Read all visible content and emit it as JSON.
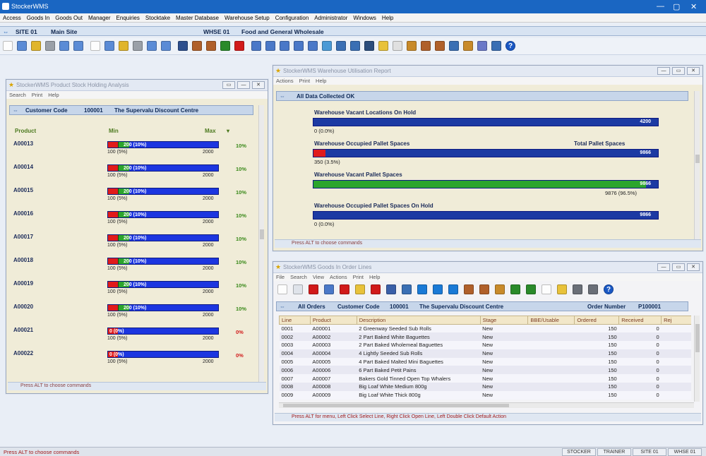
{
  "app": {
    "title": "StockerWMS"
  },
  "menu": [
    "Access",
    "Goods In",
    "Goods Out",
    "Manager",
    "Enquiries",
    "Stocktake",
    "Master Database",
    "Warehouse Setup",
    "Configuration",
    "Administrator",
    "Windows",
    "Help"
  ],
  "site": {
    "code": "SITE 01",
    "name": "Main Site",
    "warehouse": "WHSE 01",
    "warehouse_name": "Food and General Wholesale"
  },
  "stock_window": {
    "title": "StockerWMS Product Stock Holding Analysis",
    "menu": [
      "Search",
      "Print",
      "Help"
    ],
    "header_label": "Customer Code",
    "customer_code": "100001",
    "customer_name": "The Supervalu Discount Centre",
    "col_product": "Product",
    "col_min": "Min",
    "col_max": "Max",
    "status": "Press ALT to choose commands",
    "colors": {
      "bar_blue": "#1c36e0",
      "bar_red": "#e01b1b",
      "bar_green": "#2ca52c",
      "pct_ok": "#3a8a1a",
      "pct_bad": "#d11a1a"
    },
    "rows": [
      {
        "product": "A00013",
        "label": "200 (10%)",
        "level": 0.1,
        "min": "100 (5%)",
        "max": "2000",
        "pct": "10%",
        "ok": true
      },
      {
        "product": "A00014",
        "label": "200 (10%)",
        "level": 0.1,
        "min": "100 (5%)",
        "max": "2000",
        "pct": "10%",
        "ok": true
      },
      {
        "product": "A00015",
        "label": "200 (10%)",
        "level": 0.1,
        "min": "100 (5%)",
        "max": "2000",
        "pct": "10%",
        "ok": true
      },
      {
        "product": "A00016",
        "label": "200 (10%)",
        "level": 0.1,
        "min": "100 (5%)",
        "max": "2000",
        "pct": "10%",
        "ok": true
      },
      {
        "product": "A00017",
        "label": "200 (10%)",
        "level": 0.1,
        "min": "100 (5%)",
        "max": "2000",
        "pct": "10%",
        "ok": true
      },
      {
        "product": "A00018",
        "label": "200 (10%)",
        "level": 0.1,
        "min": "100 (5%)",
        "max": "2000",
        "pct": "10%",
        "ok": true
      },
      {
        "product": "A00019",
        "label": "200 (10%)",
        "level": 0.1,
        "min": "100 (5%)",
        "max": "2000",
        "pct": "10%",
        "ok": true
      },
      {
        "product": "A00020",
        "label": "200 (10%)",
        "level": 0.1,
        "min": "100 (5%)",
        "max": "2000",
        "pct": "10%",
        "ok": true
      },
      {
        "product": "A00021",
        "label": "0 (0%)",
        "level": 0,
        "min": "100 (5%)",
        "max": "2000",
        "pct": "0%",
        "ok": false
      },
      {
        "product": "A00022",
        "label": "0 (0%)",
        "level": 0,
        "min": "100 (5%)",
        "max": "2000",
        "pct": "0%",
        "ok": false
      }
    ]
  },
  "util_window": {
    "title": "StockerWMS Warehouse Utilisation Report",
    "menu": [
      "Actions",
      "Print",
      "Help"
    ],
    "header": "All Data Collected OK",
    "status": "Press ALT to choose commands",
    "bars": [
      {
        "label": "Warehouse Vacant Locations On Hold",
        "value": "4200",
        "fill": 0,
        "sub": "0 (0.0%)",
        "color": "#1c3aa3"
      },
      {
        "label": "Warehouse Occupied Pallet Spaces",
        "right_label": "Total Pallet Spaces",
        "value": "9866",
        "fill": 0.035,
        "sub": "350 (3.5%)",
        "color": "#1c3aa3"
      },
      {
        "label": "Warehouse Vacant Pallet Spaces",
        "value": "9866",
        "fill": 0.965,
        "sub": "9876 (96.5%)",
        "color": "#2ca52c"
      },
      {
        "label": "Warehouse Occupied Pallet Spaces On Hold",
        "value": "9866",
        "fill": 0,
        "sub": "0 (0.0%)",
        "color": "#1c3aa3"
      }
    ]
  },
  "orders_window": {
    "title": "StockerWMS Goods In Order Lines",
    "menu": [
      "File",
      "Search",
      "View",
      "Actions",
      "Print",
      "Help"
    ],
    "header_all": "All Orders",
    "header_label": "Customer Code",
    "customer_code": "100001",
    "customer_name": "The Supervalu Discount Centre",
    "order_label": "Order Number",
    "order_number": "P100001",
    "columns": [
      "Line",
      "Product",
      "Description",
      "Stage",
      "BBE/Usable",
      "Ordered",
      "Received",
      "Rej"
    ],
    "rows": [
      [
        "0001",
        "A00001",
        "2 Greenway Seeded Sub Rolls",
        "New",
        "",
        "150",
        "0",
        ""
      ],
      [
        "0002",
        "A00002",
        "2 Part Baked White Baguettes",
        "New",
        "",
        "150",
        "0",
        ""
      ],
      [
        "0003",
        "A00003",
        "2 Part Baked Wholemeal Baguettes",
        "New",
        "",
        "150",
        "0",
        ""
      ],
      [
        "0004",
        "A00004",
        "4 Lightly Seeded Sub Rolls",
        "New",
        "",
        "150",
        "0",
        ""
      ],
      [
        "0005",
        "A00005",
        "4 Part Baked Malted Mini Baguettes",
        "New",
        "",
        "150",
        "0",
        ""
      ],
      [
        "0006",
        "A00006",
        "6 Part Baked Petit Pains",
        "New",
        "",
        "150",
        "0",
        ""
      ],
      [
        "0007",
        "A00007",
        "Bakers Gold Tinned Open Top Whalers",
        "New",
        "",
        "150",
        "0",
        ""
      ],
      [
        "0008",
        "A00008",
        "Big Loaf White Medium 800g",
        "New",
        "",
        "150",
        "0",
        ""
      ],
      [
        "0009",
        "A00009",
        "Big Loaf White Thick 800g",
        "New",
        "",
        "150",
        "0",
        ""
      ]
    ],
    "status": "Press ALT for menu, Left Click Select Line, Right Click Open Line, Left Double Click Default Action"
  },
  "bottom_status": {
    "message": "Press ALT to choose commands",
    "boxes": [
      "STOCKER",
      "TRAINER",
      "SITE 01",
      "WHSE 01"
    ]
  }
}
